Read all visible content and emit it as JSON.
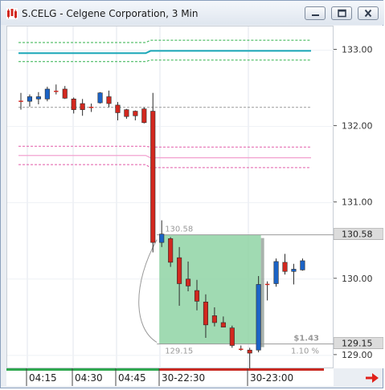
{
  "window": {
    "title": "S.CELG - Celgene Corporation, 3 Min",
    "controls": [
      "minimize",
      "restore",
      "close"
    ]
  },
  "chart_data": {
    "type": "candlestick",
    "title": "S.CELG - Celgene Corporation, 3 Min",
    "symbol": "S.CELG",
    "interval": "3 Min",
    "y_ticks": [
      "133.00",
      "132.00",
      "131.00",
      "130.00",
      "129.00"
    ],
    "ylim": [
      128.82,
      133.31
    ],
    "x_ticks": [
      "04:15",
      "04:30",
      "04:45",
      "30-22:30",
      "30-23:00"
    ],
    "price_flags": {
      "upper": "130.58",
      "lower": "129.15"
    },
    "measure_box": {
      "top_price_label": "130.58",
      "bottom_price_label": "129.15",
      "change_label": "$1.43",
      "percent_label": "1.10 %",
      "high": 130.58,
      "low": 129.15,
      "color": "#8fd4a4"
    },
    "candles": [
      {
        "o": 132.33,
        "h": 132.44,
        "l": 132.22,
        "c": 132.33
      },
      {
        "o": 132.33,
        "h": 132.42,
        "l": 132.26,
        "c": 132.39
      },
      {
        "o": 132.36,
        "h": 132.45,
        "l": 132.29,
        "c": 132.39
      },
      {
        "o": 132.36,
        "h": 132.52,
        "l": 132.33,
        "c": 132.49
      },
      {
        "o": 132.46,
        "h": 132.55,
        "l": 132.42,
        "c": 132.46
      },
      {
        "o": 132.49,
        "h": 132.53,
        "l": 132.36,
        "c": 132.37
      },
      {
        "o": 132.36,
        "h": 132.38,
        "l": 132.17,
        "c": 132.22
      },
      {
        "o": 132.3,
        "h": 132.36,
        "l": 132.14,
        "c": 132.22
      },
      {
        "o": 132.25,
        "h": 132.3,
        "l": 132.19,
        "c": 132.25
      },
      {
        "o": 132.31,
        "h": 132.45,
        "l": 132.3,
        "c": 132.44
      },
      {
        "o": 132.39,
        "h": 132.47,
        "l": 132.25,
        "c": 132.3
      },
      {
        "o": 132.28,
        "h": 132.32,
        "l": 132.08,
        "c": 132.18
      },
      {
        "o": 132.22,
        "h": 132.23,
        "l": 132.1,
        "c": 132.13
      },
      {
        "o": 132.2,
        "h": 132.21,
        "l": 132.08,
        "c": 132.14
      },
      {
        "o": 132.23,
        "h": 132.25,
        "l": 132.04,
        "c": 132.05
      },
      {
        "o": 132.2,
        "h": 132.44,
        "l": 130.35,
        "c": 130.48
      },
      {
        "o": 130.48,
        "h": 130.77,
        "l": 130.42,
        "c": 130.59
      },
      {
        "o": 130.53,
        "h": 130.55,
        "l": 130.16,
        "c": 130.22
      },
      {
        "o": 130.28,
        "h": 130.42,
        "l": 129.65,
        "c": 129.94
      },
      {
        "o": 130.0,
        "h": 130.23,
        "l": 129.84,
        "c": 129.91
      },
      {
        "o": 129.85,
        "h": 129.99,
        "l": 129.59,
        "c": 129.71
      },
      {
        "o": 129.7,
        "h": 129.8,
        "l": 129.23,
        "c": 129.4
      },
      {
        "o": 129.52,
        "h": 129.63,
        "l": 129.38,
        "c": 129.43
      },
      {
        "o": 129.43,
        "h": 129.51,
        "l": 129.37,
        "c": 129.37
      },
      {
        "o": 129.36,
        "h": 129.39,
        "l": 129.1,
        "c": 129.13
      },
      {
        "o": 129.08,
        "h": 129.13,
        "l": 129.06,
        "c": 129.07
      },
      {
        "o": 129.07,
        "h": 129.1,
        "l": 128.82,
        "c": 129.03
      },
      {
        "o": 129.07,
        "h": 130.04,
        "l": 129.04,
        "c": 129.93
      },
      {
        "o": 129.93,
        "h": 129.97,
        "l": 129.72,
        "c": 129.92
      },
      {
        "o": 129.94,
        "h": 130.27,
        "l": 129.9,
        "c": 130.23
      },
      {
        "o": 130.22,
        "h": 130.33,
        "l": 130.06,
        "c": 130.1
      },
      {
        "o": 130.1,
        "h": 130.2,
        "l": 129.93,
        "c": 130.13
      },
      {
        "o": 130.12,
        "h": 130.27,
        "l": 130.11,
        "c": 130.24
      }
    ],
    "colors": {
      "up": "#1b63c6",
      "down": "#d2281f",
      "doji": "#d2281f"
    },
    "bands": [
      {
        "name": "outer-upper-green",
        "before": 133.1,
        "after": 133.13,
        "color": "#2fb14a",
        "dash": true
      },
      {
        "name": "mid-cyan",
        "before": 132.96,
        "after": 132.99,
        "color": "#1aa7b8",
        "dash": false
      },
      {
        "name": "inner-upper-green",
        "before": 132.85,
        "after": 132.87,
        "color": "#2fb14a",
        "dash": true
      },
      {
        "name": "mid-grey",
        "before": 132.25,
        "after": 132.25,
        "color": "#9a9a9a",
        "dash": true
      },
      {
        "name": "pink-upper",
        "before": 131.74,
        "after": 131.73,
        "color": "#e25aa8",
        "dash": true
      },
      {
        "name": "pink-mid",
        "before": 131.62,
        "after": 131.59,
        "color": "#f2a2d0",
        "dash": false
      },
      {
        "name": "pink-lower",
        "before": 131.5,
        "after": 131.46,
        "color": "#e25aa8",
        "dash": true
      }
    ],
    "band_break_index": 15
  }
}
